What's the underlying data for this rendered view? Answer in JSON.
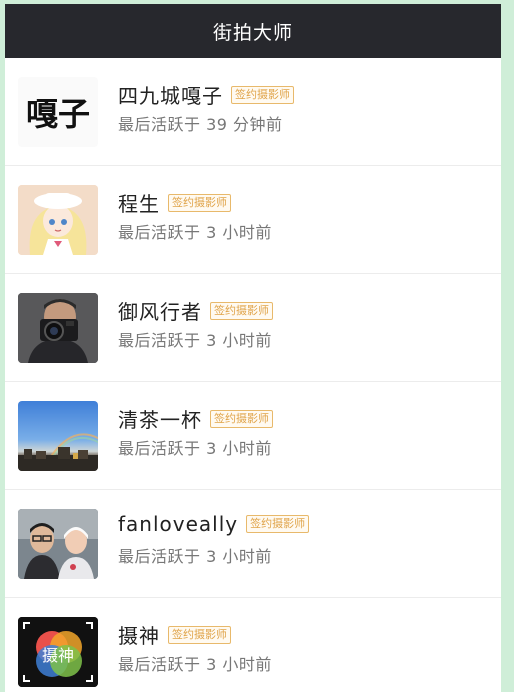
{
  "header": {
    "title": "街拍大师"
  },
  "photographers": [
    {
      "name": "四九城嘎子",
      "badge": "签约摄影师",
      "activity": "最后活跃于 39 分钟前",
      "avatar": "calligraphy-avatar",
      "avatar_text": "嘎子"
    },
    {
      "name": "程生",
      "badge": "签约摄影师",
      "activity": "最后活跃于 3 小时前",
      "avatar": "anime-girl-avatar"
    },
    {
      "name": "御风行者",
      "badge": "签约摄影师",
      "activity": "最后活跃于 3 小时前",
      "avatar": "camera-man-avatar"
    },
    {
      "name": "清茶一杯",
      "badge": "签约摄影师",
      "activity": "最后活跃于 3 小时前",
      "avatar": "rainbow-sky-avatar"
    },
    {
      "name": "fanloveally",
      "badge": "签约摄影师",
      "activity": "最后活跃于 3 小时前",
      "avatar": "couple-photo-avatar"
    },
    {
      "name": "摄神",
      "badge": "签约摄影师",
      "activity": "最后活跃于 3 小时前",
      "avatar": "logo-avatar",
      "avatar_text": "摄神"
    }
  ],
  "colors": {
    "navbar": "#27282d",
    "badge": "#e0a44a",
    "page_bg": "#cfeed8"
  }
}
